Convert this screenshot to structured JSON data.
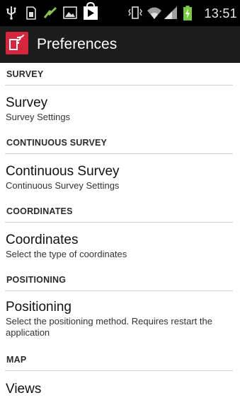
{
  "status_bar": {
    "time": "13:51",
    "icons": [
      "usb-icon",
      "sim-card-icon",
      "signal-booster-icon",
      "image-icon",
      "play-store-icon",
      "vibrate-icon",
      "wifi-icon",
      "cell-signal-icon",
      "battery-charging-icon"
    ]
  },
  "action_bar": {
    "title": "Preferences"
  },
  "categories": [
    {
      "label": "SURVEY"
    },
    {
      "label": "CONTINUOUS SURVEY"
    },
    {
      "label": "COORDINATES"
    },
    {
      "label": "POSITIONING"
    },
    {
      "label": "MAP"
    }
  ],
  "items": [
    {
      "title": "Survey",
      "summary": "Survey Settings"
    },
    {
      "title": "Continuous Survey",
      "summary": "Continuous Survey Settings"
    },
    {
      "title": "Coordinates",
      "summary": "Select the type of coordinates"
    },
    {
      "title": "Positioning",
      "summary": "Select the positioning method. Requires restart the application"
    },
    {
      "title": "Views",
      "summary": ""
    }
  ],
  "colors": {
    "status_bar_bg": "#000000",
    "action_bar_bg": "#1c1c1c",
    "logo_red": "#d6263e",
    "battery_green": "#7ac943"
  }
}
